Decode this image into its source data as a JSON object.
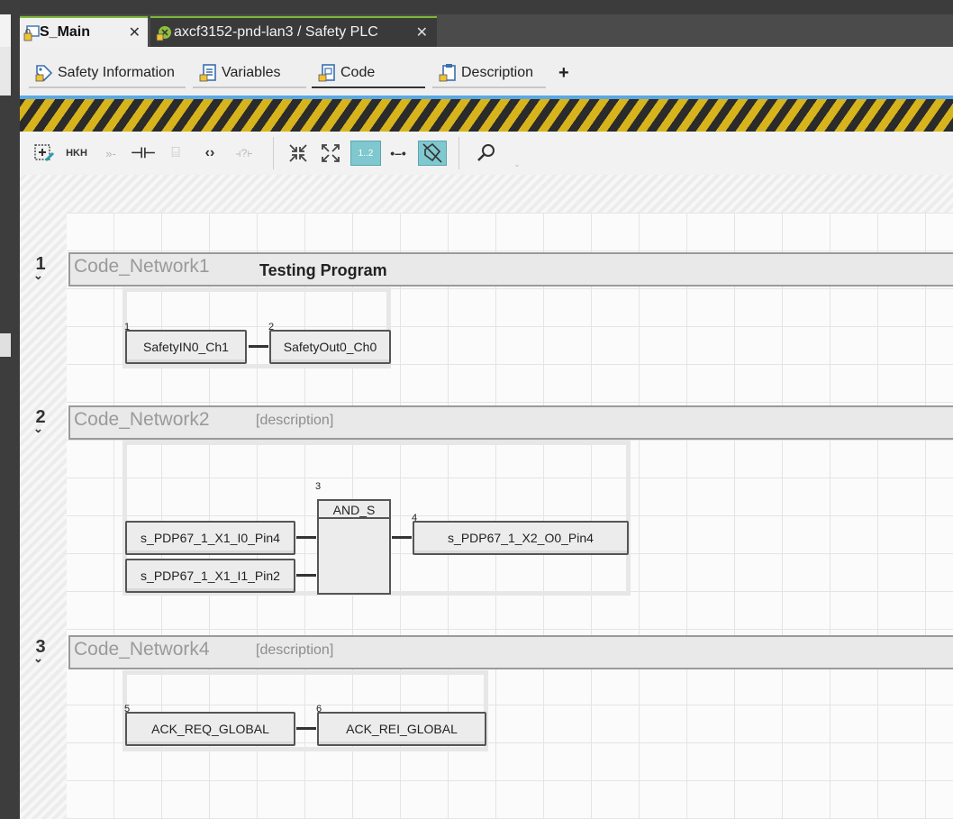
{
  "doc_tabs": [
    {
      "label": "S_Main",
      "active": true
    },
    {
      "label": "axcf3152-pnd-lan3 / Safety PLC",
      "active": false
    }
  ],
  "close_glyph": "✕",
  "sub_tabs": [
    {
      "label": "Safety Information",
      "icon": "safety-information-icon"
    },
    {
      "label": "Variables",
      "icon": "variables-icon"
    },
    {
      "label": "Code",
      "icon": "code-icon",
      "active": true
    },
    {
      "label": "Description",
      "icon": "description-icon"
    }
  ],
  "add_tab_glyph": "+",
  "toolbar": {
    "icons": [
      "insert-network-icon",
      "contact-icon",
      "coil-icon",
      "parallel-icon",
      "block-icon",
      "bracket-icon",
      "negate-icon",
      "collapse-icon",
      "expand-icon",
      "numbering-icon",
      "connection-icon",
      "safety-view-icon",
      "search-icon"
    ],
    "numbering_label": "1..2"
  },
  "colors": {
    "accent_green": "#7db83a",
    "accent_blue": "#5aa9e6",
    "hazard_yellow": "#d8b41c",
    "toggle_teal": "#7fc8cf"
  },
  "networks": [
    {
      "number": "1",
      "name": "Code_Network1",
      "description": "Testing Program",
      "blocks": [
        {
          "index": "1",
          "label": "SafetyIN0_Ch1"
        },
        {
          "index": "2",
          "label": "SafetyOut0_Ch0"
        }
      ]
    },
    {
      "number": "2",
      "name": "Code_Network2",
      "description": "[description]",
      "inputs": [
        {
          "label": "s_PDP67_1_X1_I0_Pin4"
        },
        {
          "label": "s_PDP67_1_X1_I1_Pin2"
        }
      ],
      "function_block": {
        "index": "3",
        "label": "AND_S"
      },
      "output": {
        "index": "4",
        "label": "s_PDP67_1_X2_O0_Pin4"
      }
    },
    {
      "number": "3",
      "name": "Code_Network4",
      "description": "[description]",
      "blocks": [
        {
          "index": "5",
          "label": "ACK_REQ_GLOBAL"
        },
        {
          "index": "6",
          "label": "ACK_REI_GLOBAL"
        }
      ]
    }
  ]
}
